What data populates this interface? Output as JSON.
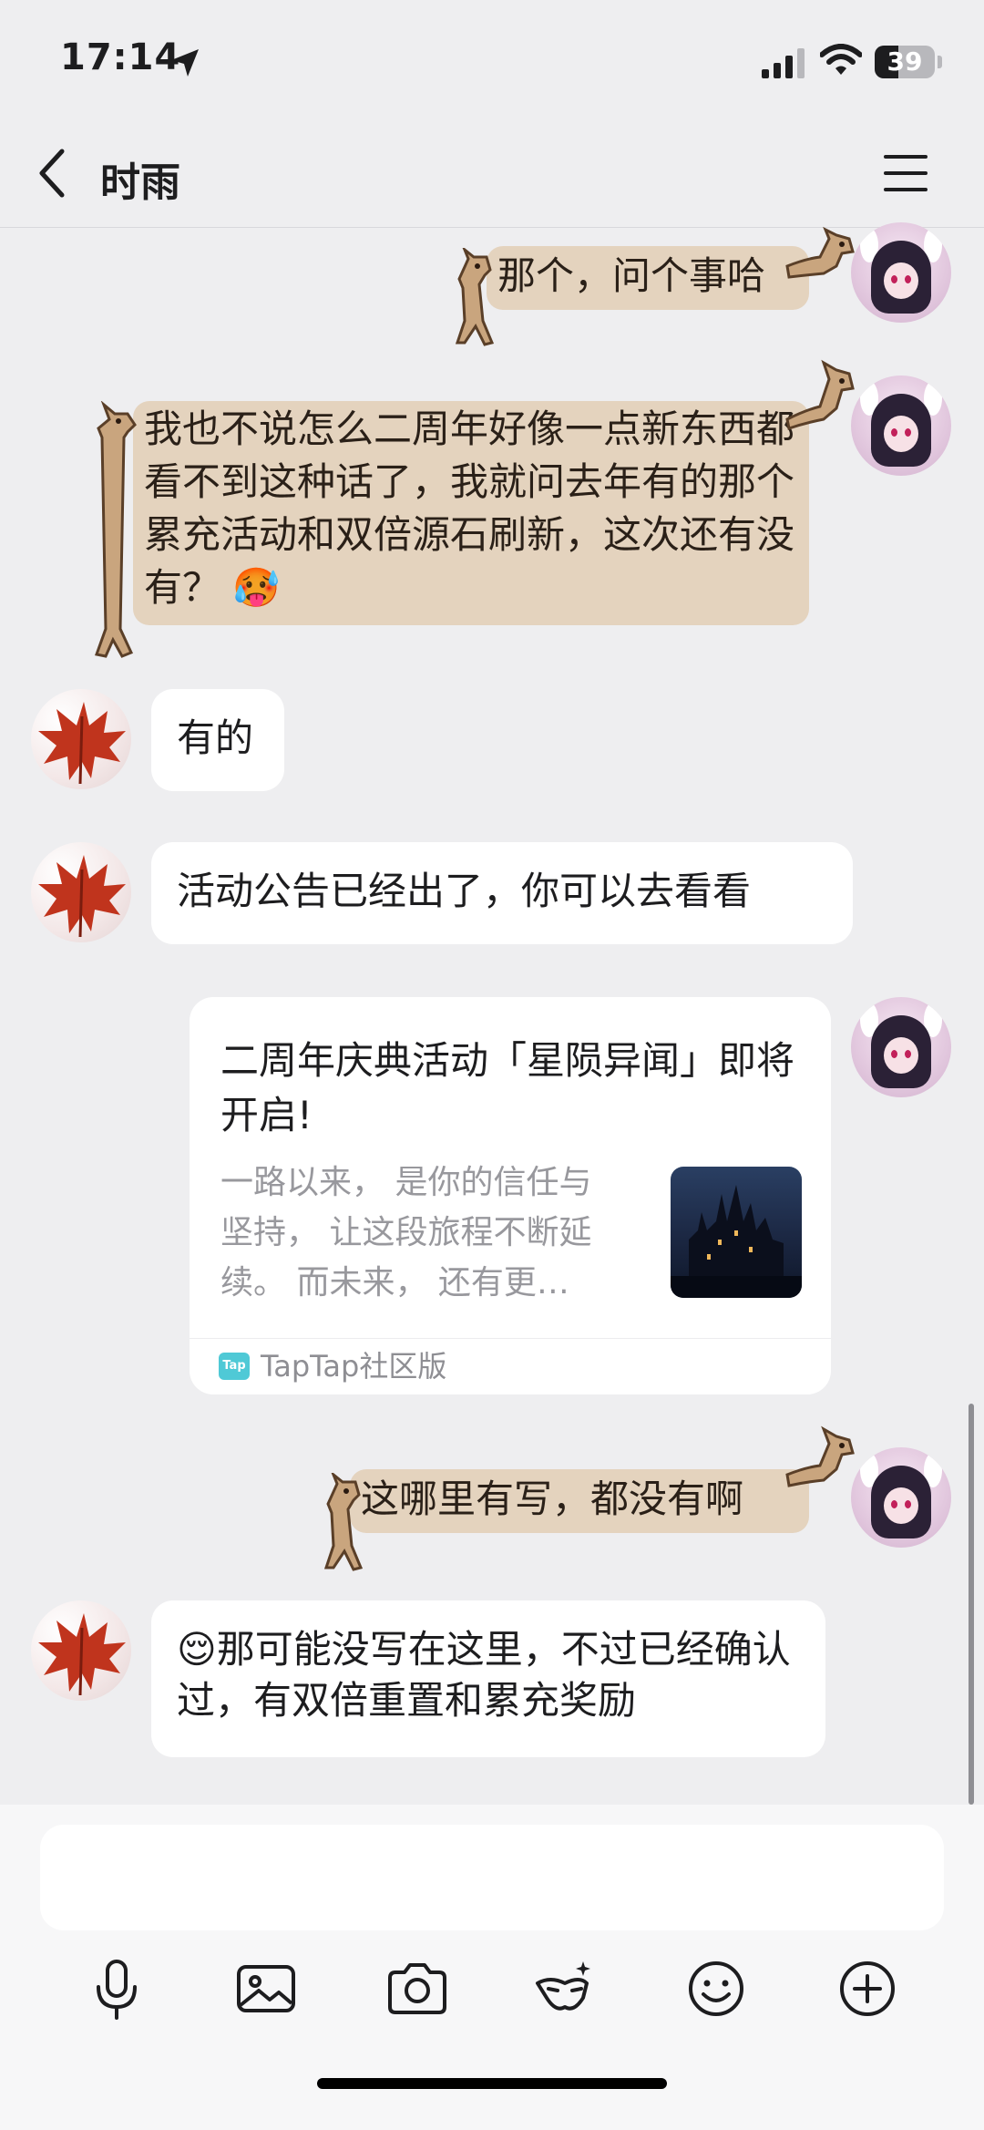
{
  "status_bar": {
    "time": "17:14",
    "battery": "39",
    "battery_level": 0.39
  },
  "header": {
    "title": "时雨"
  },
  "messages": [
    {
      "sender": "me",
      "text": "那个，问个事哈"
    },
    {
      "sender": "me",
      "text": "我也不说怎么二周年好像一点新东西都看不到这种话了，我就问去年有的那个累充活动和双倍源石刷新，这次还有没有？",
      "emoji": "🥵"
    },
    {
      "sender": "other",
      "text": "有的"
    },
    {
      "sender": "other",
      "text": "活动公告已经出了，你可以去看看"
    },
    {
      "sender": "me",
      "type": "link-card",
      "card": {
        "title": "二周年庆典活动「星陨异闻」即将开启!",
        "description": "一路以来， 是你的信任与坚持， 让这段旅程不断延续。 而未来， 还有更…",
        "source": "TapTap社区版",
        "source_icon": "Tap"
      }
    },
    {
      "sender": "me",
      "text": "这哪里有写，都没有啊"
    },
    {
      "sender": "other",
      "text": "那可能没写在这里，不过已经确认过，有双倍重置和累充奖励",
      "emoji": "😌"
    }
  ],
  "toolbar": {
    "buttons": [
      "microphone-icon",
      "image-icon",
      "camera-icon",
      "mask-icon",
      "emoji-icon",
      "plus-icon"
    ]
  },
  "colors": {
    "background": "#eeeef0",
    "bubble_other": "#ffffff",
    "bubble_me": "#e4d3be",
    "input_area": "#f7f7f8"
  }
}
